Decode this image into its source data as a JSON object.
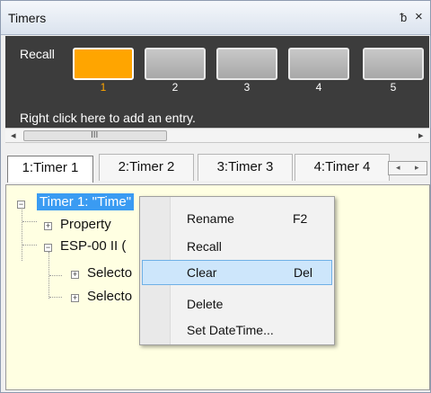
{
  "window": {
    "title": "Timers",
    "pin_glyph": "ᵬ",
    "close_glyph": "×"
  },
  "recall": {
    "label": "Recall",
    "slots": [
      "1",
      "2",
      "3",
      "4",
      "5"
    ],
    "active_index": 0,
    "hint": "Right click here to add an entry.",
    "active_color": "#ffa500"
  },
  "scrollbar": {
    "left_arrow": "◂",
    "grip": "III",
    "right_arrow": "▸"
  },
  "tabs": [
    {
      "label": "1:Timer 1",
      "active": true
    },
    {
      "label": "2:Timer 2",
      "active": false
    },
    {
      "label": "3:Timer 3",
      "active": false
    },
    {
      "label": "4:Timer 4",
      "active": false
    }
  ],
  "tab_nav": {
    "prev": "◂",
    "next": "▸"
  },
  "tree": {
    "root": "Timer 1: \"Time\"",
    "root_toggle": "−",
    "children": [
      {
        "label": "Property",
        "toggle": "+"
      },
      {
        "label": "ESP-00 II (",
        "toggle": "−"
      }
    ],
    "grandchildren": [
      {
        "label": "Selecto",
        "toggle": "+"
      },
      {
        "label": "Selecto",
        "toggle": "+"
      }
    ]
  },
  "context_menu": {
    "items": [
      {
        "label": "Rename",
        "shortcut": "F2",
        "highlighted": false
      },
      {
        "label": "Recall",
        "shortcut": "",
        "highlighted": false
      },
      {
        "label": "Clear",
        "shortcut": "Del",
        "highlighted": true
      },
      {
        "label": "Delete",
        "shortcut": "",
        "highlighted": false
      },
      {
        "label": "Set DateTime...",
        "shortcut": "",
        "highlighted": false
      }
    ]
  }
}
